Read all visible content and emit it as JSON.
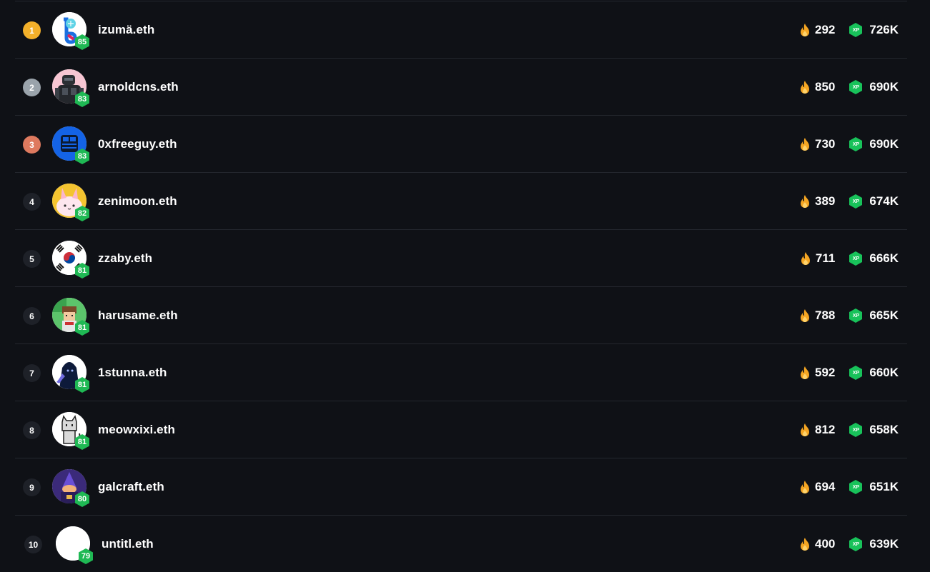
{
  "leaderboard": {
    "rows": [
      {
        "rank": "1",
        "name": "izumä.eth",
        "level": "85",
        "streak": "292",
        "xp": "726K",
        "rank_color": "#f3b02a",
        "avatar": "blue-letter"
      },
      {
        "rank": "2",
        "name": "arnoldcns.eth",
        "level": "83",
        "streak": "850",
        "xp": "690K",
        "rank_color": "#9aa3ab",
        "avatar": "robot-pink"
      },
      {
        "rank": "3",
        "name": "0xfreeguy.eth",
        "level": "83",
        "streak": "730",
        "xp": "690K",
        "rank_color": "#de7a5f",
        "avatar": "blue-ghost"
      },
      {
        "rank": "4",
        "name": "zenimoon.eth",
        "level": "82",
        "streak": "389",
        "xp": "674K",
        "rank_color": "#1e2128",
        "avatar": "pink-bunny"
      },
      {
        "rank": "5",
        "name": "zzaby.eth",
        "level": "81",
        "streak": "711",
        "xp": "666K",
        "rank_color": "#1e2128",
        "avatar": "korea-flag"
      },
      {
        "rank": "6",
        "name": "harusame.eth",
        "level": "81",
        "streak": "788",
        "xp": "665K",
        "rank_color": "#1e2128",
        "avatar": "pixel-boy"
      },
      {
        "rank": "7",
        "name": "1stunna.eth",
        "level": "81",
        "streak": "592",
        "xp": "660K",
        "rank_color": "#1e2128",
        "avatar": "hooded-figure"
      },
      {
        "rank": "8",
        "name": "meowxixi.eth",
        "level": "81",
        "streak": "812",
        "xp": "658K",
        "rank_color": "#1e2128",
        "avatar": "pixel-cat"
      },
      {
        "rank": "9",
        "name": "galcraft.eth",
        "level": "80",
        "streak": "694",
        "xp": "651K",
        "rank_color": "#1e2128",
        "avatar": "purple-wizard"
      },
      {
        "rank": "10",
        "name": "untitl.eth",
        "level": "79",
        "streak": "400",
        "xp": "639K",
        "rank_color": "#1e2128",
        "avatar": "blank-white"
      }
    ],
    "xp_badge_label": "XP",
    "colors": {
      "background": "#0f1116",
      "divider": "#24272e",
      "level_badge": "#1fb954",
      "xp_badge": "#18c25a",
      "flame": "#f5a623"
    },
    "icons": {
      "streak": "flame-icon",
      "xp": "xp-hexagon-icon",
      "level": "level-hexagon-badge"
    }
  }
}
